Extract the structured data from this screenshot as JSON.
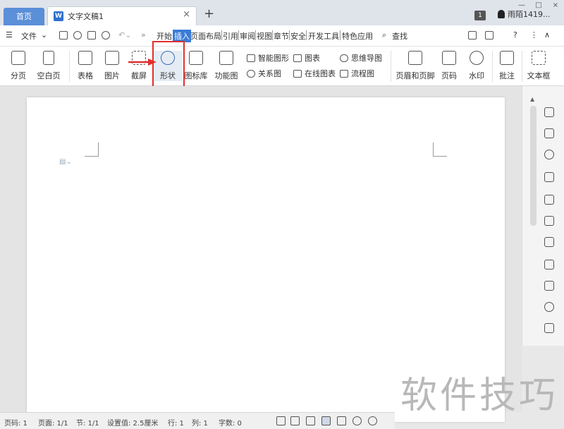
{
  "tabs": {
    "home": "首页",
    "doc_title": "文字文稿1",
    "doc_icon": "W",
    "new_tab": "+"
  },
  "titlebar": {
    "badge": "1",
    "user": "雨陌1419..."
  },
  "menu": {
    "file": "文件",
    "items": [
      "开始",
      "插入",
      "页面布局",
      "引用",
      "审阅",
      "视图",
      "章节",
      "安全",
      "开发工具",
      "特色应用"
    ],
    "active": "插入",
    "search": "查找"
  },
  "ribbon": {
    "page_break": "分页",
    "blank_page": "空白页",
    "table": "表格",
    "picture": "图片",
    "screenshot": "截屏",
    "shape": "形状",
    "icon_lib": "图标库",
    "function_chart": "功能图",
    "smart_shape": "智能图形",
    "relation_chart": "关系图",
    "chart": "图表",
    "online_chart": "在线图表",
    "mind_map": "思维导图",
    "flowchart": "流程图",
    "header_footer": "页眉和页脚",
    "page_number": "页码",
    "watermark_btn": "水印",
    "comment": "批注",
    "textbox": "文本框"
  },
  "status": {
    "page_no": "页码: 1",
    "pages": "页面: 1/1",
    "section": "节: 1/1",
    "setting": "设置值: 2.5厘米",
    "row": "行: 1",
    "col": "列: 1",
    "words": "字数: 0"
  },
  "watermark_text": "软件技巧",
  "colors": {
    "accent": "#3a7bd5",
    "highlight": "#e03030"
  }
}
